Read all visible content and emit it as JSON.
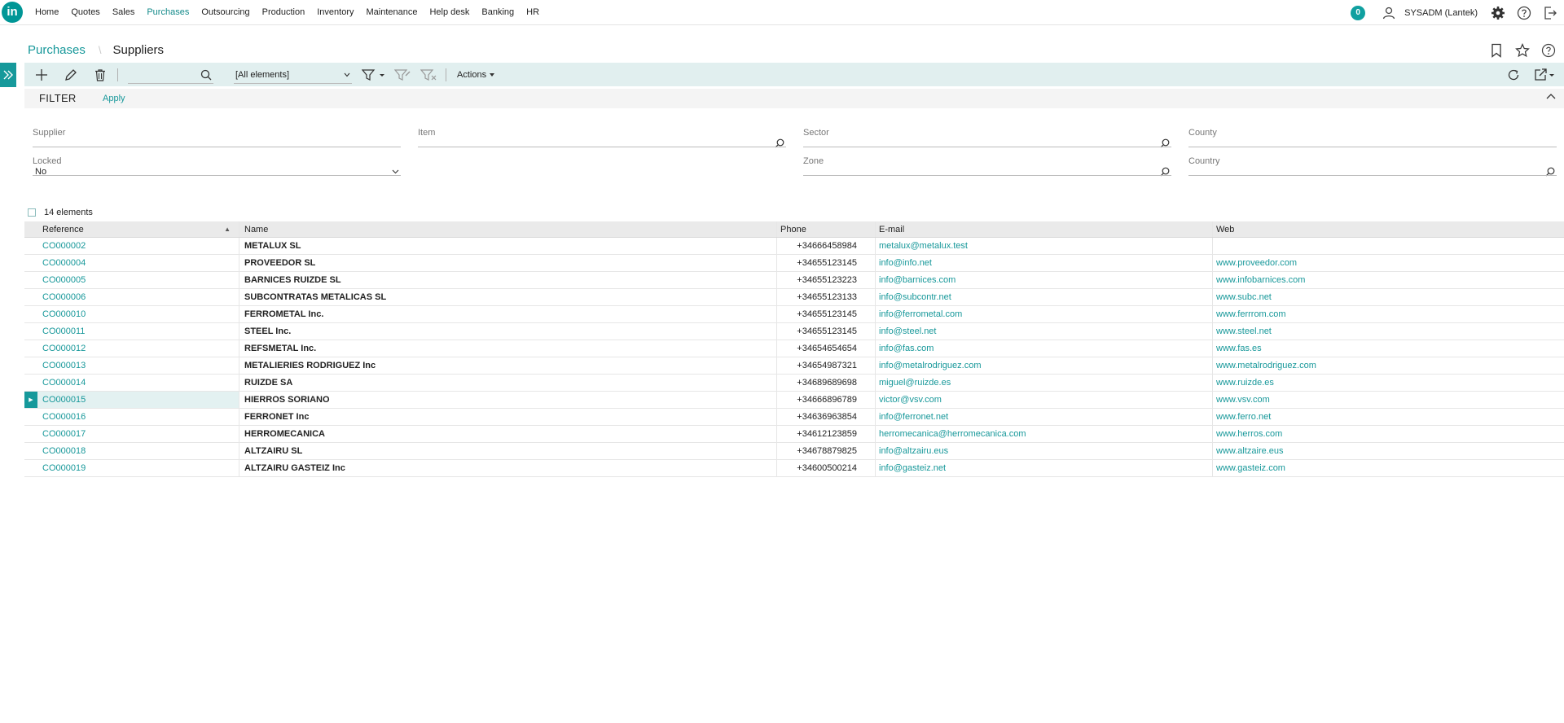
{
  "app": {
    "logo_text": "in"
  },
  "nav": {
    "items": [
      {
        "label": "Home"
      },
      {
        "label": "Quotes"
      },
      {
        "label": "Sales"
      },
      {
        "label": "Purchases",
        "active": true
      },
      {
        "label": "Outsourcing"
      },
      {
        "label": "Production"
      },
      {
        "label": "Inventory"
      },
      {
        "label": "Maintenance"
      },
      {
        "label": "Help desk"
      },
      {
        "label": "Banking"
      },
      {
        "label": "HR"
      }
    ]
  },
  "header": {
    "notification_count": "0",
    "user_name": "SYSADM (Lantek)"
  },
  "breadcrumb": {
    "parent": "Purchases",
    "separator": "\\",
    "current": "Suppliers"
  },
  "toolbar": {
    "search_value": "",
    "view_selected": "[All elements]",
    "actions_label": "Actions"
  },
  "filter": {
    "title": "FILTER",
    "apply_label": "Apply",
    "fields": {
      "supplier": {
        "label": "Supplier",
        "value": ""
      },
      "item": {
        "label": "Item",
        "value": ""
      },
      "sector": {
        "label": "Sector",
        "value": ""
      },
      "county": {
        "label": "County",
        "value": ""
      },
      "locked": {
        "label": "Locked",
        "value": "No"
      },
      "zone": {
        "label": "Zone",
        "value": ""
      },
      "country": {
        "label": "Country",
        "value": ""
      }
    }
  },
  "grid": {
    "count_label": "14 elements",
    "columns": {
      "reference": "Reference",
      "name": "Name",
      "phone": "Phone",
      "email": "E-mail",
      "web": "Web"
    },
    "rows": [
      {
        "ref": "CO000002",
        "name": "METALUX SL",
        "phone": "+34666458984",
        "email": "metalux@metalux.test",
        "web": ""
      },
      {
        "ref": "CO000004",
        "name": "PROVEEDOR SL",
        "phone": "+34655123145",
        "email": "info@info.net",
        "web": "www.proveedor.com"
      },
      {
        "ref": "CO000005",
        "name": "BARNICES RUIZDE SL",
        "phone": "+34655123223",
        "email": "info@barnices.com",
        "web": "www.infobarnices.com"
      },
      {
        "ref": "CO000006",
        "name": "SUBCONTRATAS METALICAS SL",
        "phone": "+34655123133",
        "email": "info@subcontr.net",
        "web": "www.subc.net"
      },
      {
        "ref": "CO000010",
        "name": "FERROMETAL Inc.",
        "phone": "+34655123145",
        "email": "info@ferrometal.com",
        "web": "www.ferrrom.com"
      },
      {
        "ref": "CO000011",
        "name": "STEEL Inc.",
        "phone": "+34655123145",
        "email": "info@steel.net",
        "web": "www.steel.net"
      },
      {
        "ref": "CO000012",
        "name": "REFSMETAL Inc.",
        "phone": "+34654654654",
        "email": "info@fas.com",
        "web": "www.fas.es"
      },
      {
        "ref": "CO000013",
        "name": "METALIERIES RODRIGUEZ Inc",
        "phone": "+34654987321",
        "email": "info@metalrodriguez.com",
        "web": "www.metalrodriguez.com"
      },
      {
        "ref": "CO000014",
        "name": "RUIZDE SA",
        "phone": "+34689689698",
        "email": "miguel@ruizde.es",
        "web": "www.ruizde.es"
      },
      {
        "ref": "CO000015",
        "name": "HIERROS SORIANO",
        "phone": "+34666896789",
        "email": "victor@vsv.com",
        "web": "www.vsv.com",
        "selected": true
      },
      {
        "ref": "CO000016",
        "name": "FERRONET Inc",
        "phone": "+34636963854",
        "email": "info@ferronet.net",
        "web": "www.ferro.net"
      },
      {
        "ref": "CO000017",
        "name": "HERROMECANICA",
        "phone": "+34612123859",
        "email": "herromecanica@herromecanica.com",
        "web": "www.herros.com"
      },
      {
        "ref": "CO000018",
        "name": "ALTZAIRU SL",
        "phone": "+34678879825",
        "email": "info@altzairu.eus",
        "web": "www.altzaire.eus"
      },
      {
        "ref": "CO000019",
        "name": "ALTZAIRU GASTEIZ Inc",
        "phone": "+34600500214",
        "email": "info@gasteiz.net",
        "web": "www.gasteiz.com"
      }
    ]
  },
  "colors": {
    "accent": "#17989a",
    "toolbar_bg": "#e1efef",
    "selected_bg": "#e3f1f1"
  }
}
